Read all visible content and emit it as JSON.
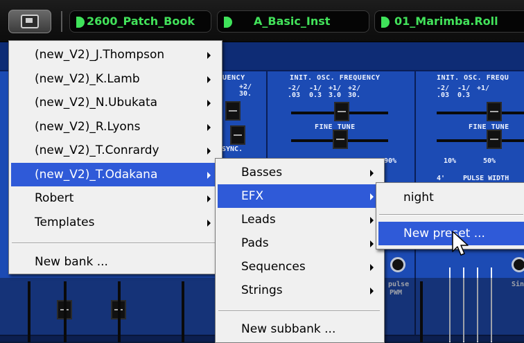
{
  "toolbar": {
    "bank_icon": "save-bank-icon",
    "bank": "2600_Patch_Book",
    "category": "A_Basic_Inst",
    "patch": "01_Marimba.Roll",
    "pill_accent": "#42e25a"
  },
  "synth": {
    "freq_title_a": "INIT. OSC. FREQUENCY",
    "freq_title_b": "INIT. OSC. FREQU",
    "freq_title_partial": "UENCY",
    "ticks_a": [
      "-2/",
      "-1/",
      "+1/",
      "+2/"
    ],
    "ticks_b": [
      ".03",
      "0.3",
      "3.0",
      "30."
    ],
    "ticks_partial": [
      "+2/",
      "30."
    ],
    "fine_tune": "FINE TUNE",
    "pct": [
      "10%",
      "50%",
      "90%"
    ],
    "pulse_width": "PULSE WIDTH",
    "pulse": "pulse",
    "pwm": "PWM",
    "sine": "Sine",
    "four": "4'",
    "sync": "SYNC."
  },
  "menu1": {
    "items": [
      {
        "label": "(new_V2)_J.Thompson",
        "submenu": true
      },
      {
        "label": "(new_V2)_K.Lamb",
        "submenu": true
      },
      {
        "label": "(new_V2)_N.Ubukata",
        "submenu": true
      },
      {
        "label": "(new_V2)_R.Lyons",
        "submenu": true
      },
      {
        "label": "(new_V2)_T.Conrardy",
        "submenu": true
      },
      {
        "label": "(new_V2)_T.Odakana",
        "submenu": true,
        "selected": true
      },
      {
        "label": "Robert",
        "submenu": true
      },
      {
        "label": "Templates",
        "submenu": true
      }
    ],
    "new_bank": "New bank ..."
  },
  "menu2": {
    "items": [
      {
        "label": "Basses",
        "submenu": true
      },
      {
        "label": "EFX",
        "submenu": true,
        "selected": true
      },
      {
        "label": "Leads",
        "submenu": true
      },
      {
        "label": "Pads",
        "submenu": true
      },
      {
        "label": "Sequences",
        "submenu": true
      },
      {
        "label": "Strings",
        "submenu": true
      }
    ],
    "new_subbank": "New subbank ..."
  },
  "menu3": {
    "items": [
      {
        "label": "night"
      },
      {
        "label": "New preset ...",
        "selected": true
      }
    ]
  },
  "colors": {
    "highlight": "#2f5ad8",
    "menu_bg": "#f0f0f0",
    "panel_blue": "#1c4bb4"
  }
}
